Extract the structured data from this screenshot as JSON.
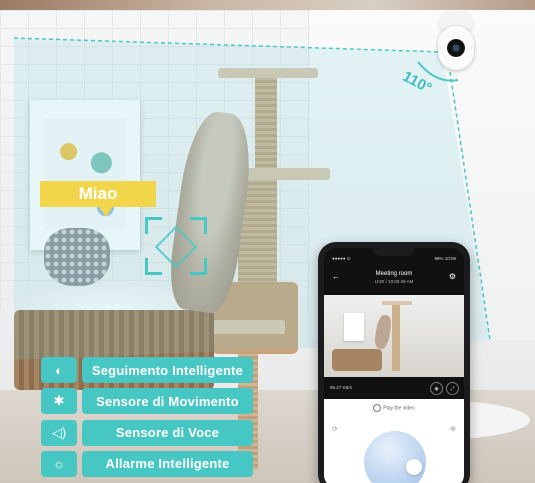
{
  "scene": {
    "angle_label": "110°",
    "speech_tag": "Miao"
  },
  "features": [
    {
      "icon": "tracking-icon",
      "glyph": "◐",
      "label": "Seguimento Intelligente"
    },
    {
      "icon": "motion-icon",
      "glyph": "✱",
      "label": "Sensore di Movimento"
    },
    {
      "icon": "sound-icon",
      "glyph": "◁)",
      "label": "Sensore di Voce"
    },
    {
      "icon": "alarm-icon",
      "glyph": "☼",
      "label": "Allarme Intelligente"
    }
  ],
  "phone": {
    "status_left": "●●●●● ⊙",
    "status_right": "98% 10:06",
    "room_title": "Meeting room",
    "room_subtitle": "LIVE / 10:06:49 AM",
    "bitrate": "95.27 KB/s",
    "play_label": "Play the video",
    "back_glyph": "←",
    "settings_glyph": "⚙",
    "snapshot_glyph": "◉",
    "fullscreen_glyph": "⤢",
    "left_glyph": "⟳",
    "right_glyph": "⊕"
  },
  "colors": {
    "accent_teal": "#46c7c3",
    "tag_yellow": "#f1d64b"
  }
}
